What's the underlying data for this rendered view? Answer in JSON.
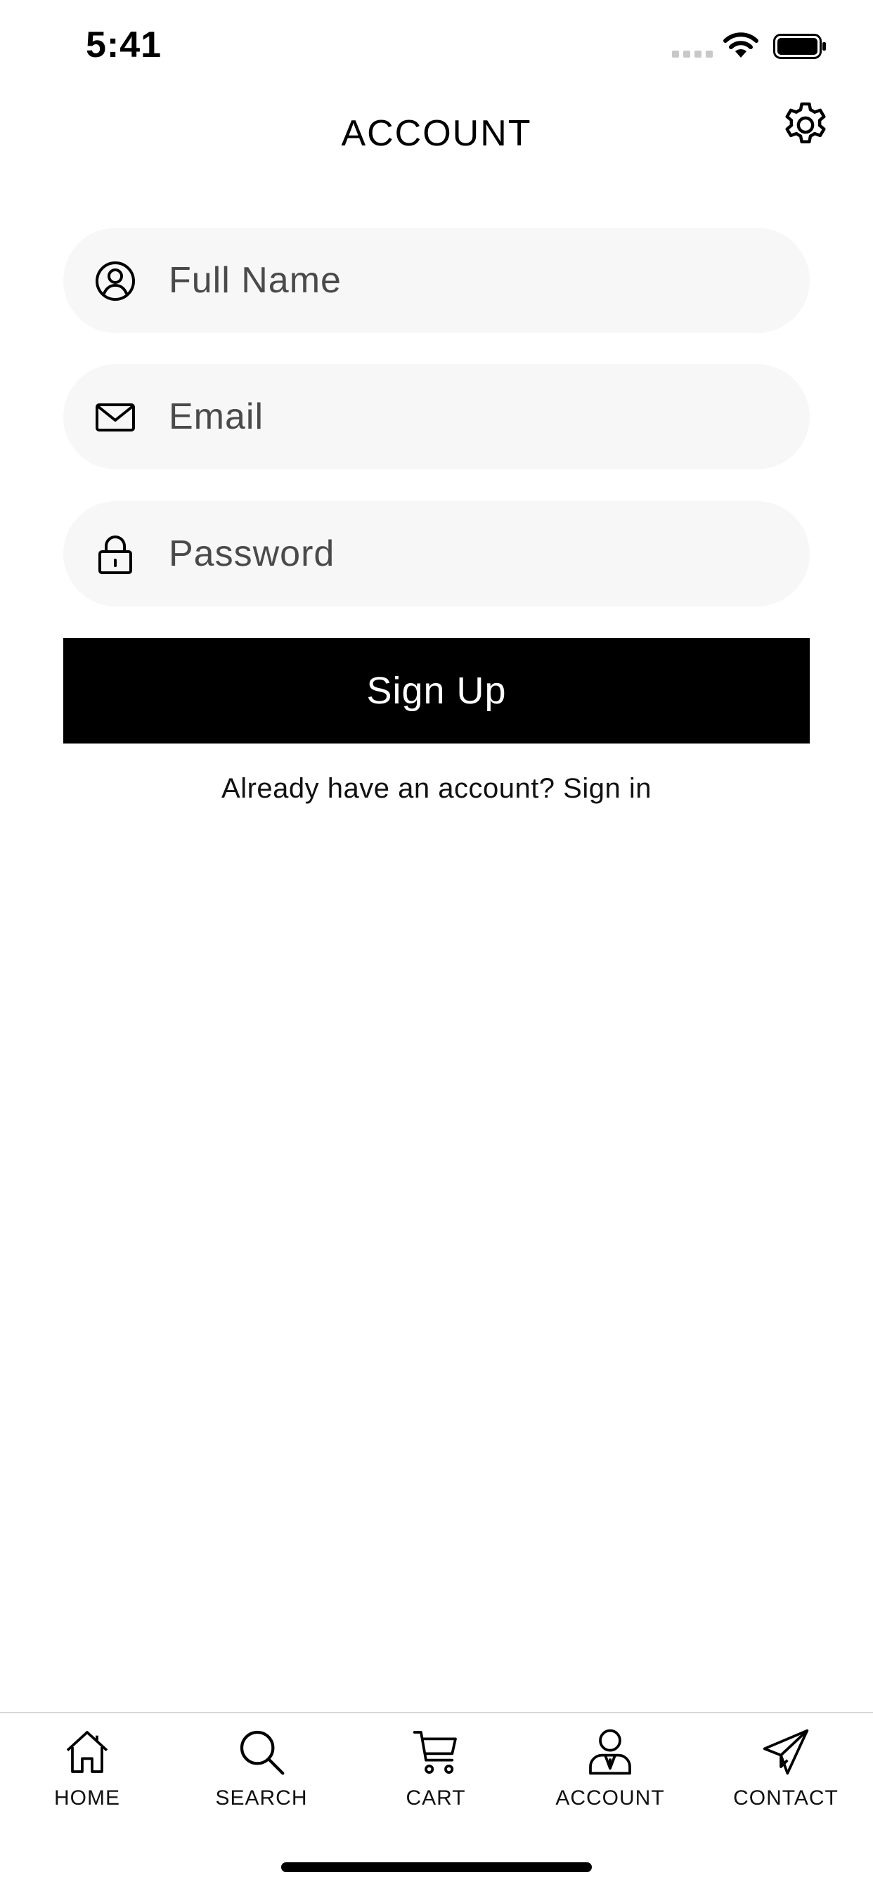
{
  "status_bar": {
    "time": "5:41"
  },
  "header": {
    "title": "ACCOUNT"
  },
  "form": {
    "full_name": {
      "value": "",
      "placeholder": "Full Name"
    },
    "email": {
      "value": "",
      "placeholder": "Email"
    },
    "password": {
      "value": "",
      "placeholder": "Password"
    },
    "submit_label": "Sign Up",
    "signin_text": "Already have an account? Sign in"
  },
  "tab_bar": {
    "items": [
      {
        "label": "HOME",
        "icon": "home-icon"
      },
      {
        "label": "SEARCH",
        "icon": "search-icon"
      },
      {
        "label": "CART",
        "icon": "cart-icon"
      },
      {
        "label": "ACCOUNT",
        "icon": "account-icon"
      },
      {
        "label": "CONTACT",
        "icon": "paper-plane-icon"
      }
    ]
  },
  "colors": {
    "background": "#ffffff",
    "field_background": "#f7f7f7",
    "button_background": "#000000",
    "button_text": "#ffffff"
  }
}
